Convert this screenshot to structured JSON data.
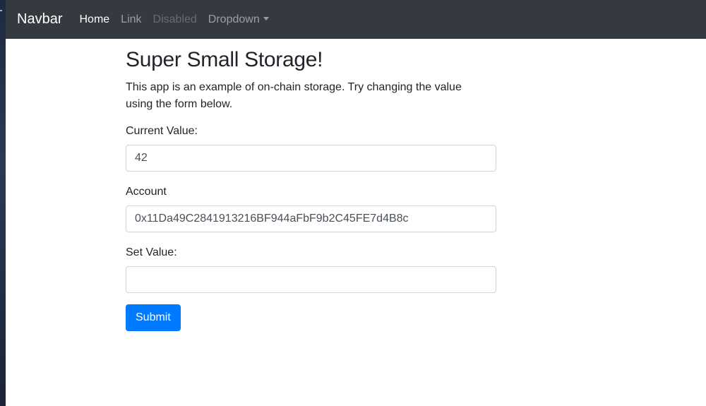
{
  "navbar": {
    "brand": "Navbar",
    "links": [
      {
        "label": "Home",
        "state": "active"
      },
      {
        "label": "Link",
        "state": "normal"
      },
      {
        "label": "Disabled",
        "state": "disabled"
      },
      {
        "label": "Dropdown",
        "state": "dropdown"
      }
    ]
  },
  "main": {
    "title": "Super Small Storage!",
    "intro": "This app is an example of on-chain storage. Try changing the value using the form below.",
    "current_value_label": "Current Value:",
    "current_value": "42",
    "account_label": "Account",
    "account_value": "0x11Da49C2841913216BF944aFbF9b2C45FE7d4B8c",
    "set_value_label": "Set Value:",
    "set_value": "",
    "submit_label": "Submit"
  },
  "colors": {
    "navbar_bg": "#343a40",
    "primary": "#007bff"
  }
}
